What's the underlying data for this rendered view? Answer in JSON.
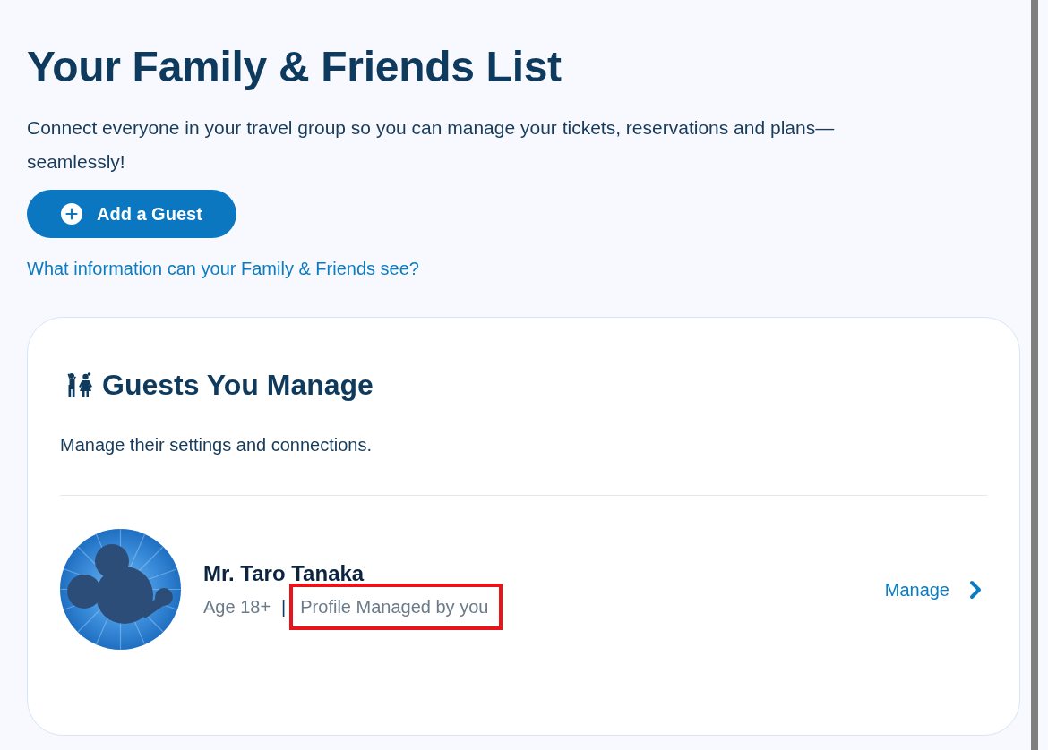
{
  "page": {
    "title": "Your Family & Friends List",
    "intro": "Connect everyone in your travel group so you can manage your tickets, reservations and plans—seamlessly!",
    "add_button": {
      "label": "Add a Guest"
    },
    "info_link": "What information can your Family & Friends see?"
  },
  "guests_card": {
    "heading": "Guests You Manage",
    "description": "Manage their settings and connections.",
    "guests": [
      {
        "name": "Mr. Taro Tanaka",
        "age": "Age 18+",
        "separator": "|",
        "status": "Profile Managed by you",
        "status_highlighted": true,
        "action": "Manage"
      }
    ]
  }
}
